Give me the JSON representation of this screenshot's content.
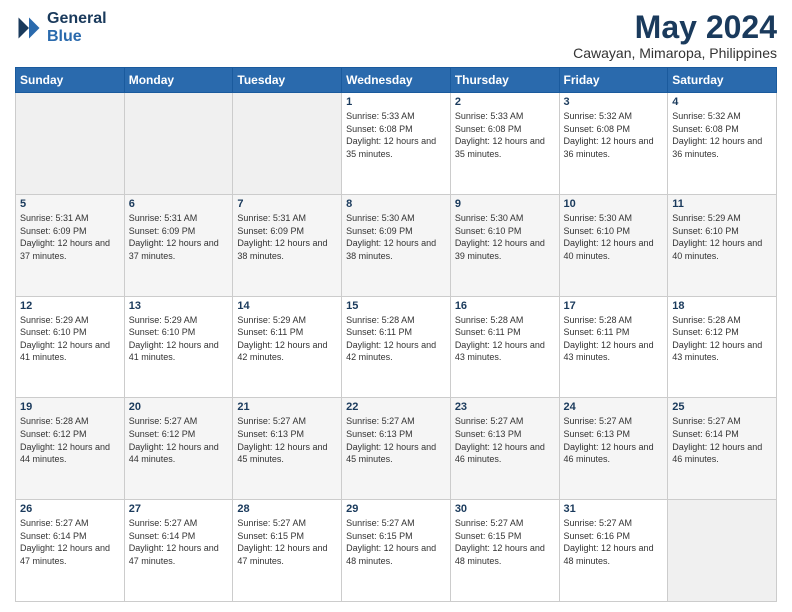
{
  "header": {
    "logo_line1": "General",
    "logo_line2": "Blue",
    "title": "May 2024",
    "subtitle": "Cawayan, Mimaropa, Philippines"
  },
  "columns": [
    "Sunday",
    "Monday",
    "Tuesday",
    "Wednesday",
    "Thursday",
    "Friday",
    "Saturday"
  ],
  "weeks": [
    [
      {
        "day": "",
        "empty": true
      },
      {
        "day": "",
        "empty": true
      },
      {
        "day": "",
        "empty": true
      },
      {
        "day": "1",
        "sunrise": "5:33 AM",
        "sunset": "6:08 PM",
        "daylight": "12 hours and 35 minutes."
      },
      {
        "day": "2",
        "sunrise": "5:33 AM",
        "sunset": "6:08 PM",
        "daylight": "12 hours and 35 minutes."
      },
      {
        "day": "3",
        "sunrise": "5:32 AM",
        "sunset": "6:08 PM",
        "daylight": "12 hours and 36 minutes."
      },
      {
        "day": "4",
        "sunrise": "5:32 AM",
        "sunset": "6:08 PM",
        "daylight": "12 hours and 36 minutes."
      }
    ],
    [
      {
        "day": "5",
        "sunrise": "5:31 AM",
        "sunset": "6:09 PM",
        "daylight": "12 hours and 37 minutes."
      },
      {
        "day": "6",
        "sunrise": "5:31 AM",
        "sunset": "6:09 PM",
        "daylight": "12 hours and 37 minutes."
      },
      {
        "day": "7",
        "sunrise": "5:31 AM",
        "sunset": "6:09 PM",
        "daylight": "12 hours and 38 minutes."
      },
      {
        "day": "8",
        "sunrise": "5:30 AM",
        "sunset": "6:09 PM",
        "daylight": "12 hours and 38 minutes."
      },
      {
        "day": "9",
        "sunrise": "5:30 AM",
        "sunset": "6:10 PM",
        "daylight": "12 hours and 39 minutes."
      },
      {
        "day": "10",
        "sunrise": "5:30 AM",
        "sunset": "6:10 PM",
        "daylight": "12 hours and 40 minutes."
      },
      {
        "day": "11",
        "sunrise": "5:29 AM",
        "sunset": "6:10 PM",
        "daylight": "12 hours and 40 minutes."
      }
    ],
    [
      {
        "day": "12",
        "sunrise": "5:29 AM",
        "sunset": "6:10 PM",
        "daylight": "12 hours and 41 minutes."
      },
      {
        "day": "13",
        "sunrise": "5:29 AM",
        "sunset": "6:10 PM",
        "daylight": "12 hours and 41 minutes."
      },
      {
        "day": "14",
        "sunrise": "5:29 AM",
        "sunset": "6:11 PM",
        "daylight": "12 hours and 42 minutes."
      },
      {
        "day": "15",
        "sunrise": "5:28 AM",
        "sunset": "6:11 PM",
        "daylight": "12 hours and 42 minutes."
      },
      {
        "day": "16",
        "sunrise": "5:28 AM",
        "sunset": "6:11 PM",
        "daylight": "12 hours and 43 minutes."
      },
      {
        "day": "17",
        "sunrise": "5:28 AM",
        "sunset": "6:11 PM",
        "daylight": "12 hours and 43 minutes."
      },
      {
        "day": "18",
        "sunrise": "5:28 AM",
        "sunset": "6:12 PM",
        "daylight": "12 hours and 43 minutes."
      }
    ],
    [
      {
        "day": "19",
        "sunrise": "5:28 AM",
        "sunset": "6:12 PM",
        "daylight": "12 hours and 44 minutes."
      },
      {
        "day": "20",
        "sunrise": "5:27 AM",
        "sunset": "6:12 PM",
        "daylight": "12 hours and 44 minutes."
      },
      {
        "day": "21",
        "sunrise": "5:27 AM",
        "sunset": "6:13 PM",
        "daylight": "12 hours and 45 minutes."
      },
      {
        "day": "22",
        "sunrise": "5:27 AM",
        "sunset": "6:13 PM",
        "daylight": "12 hours and 45 minutes."
      },
      {
        "day": "23",
        "sunrise": "5:27 AM",
        "sunset": "6:13 PM",
        "daylight": "12 hours and 46 minutes."
      },
      {
        "day": "24",
        "sunrise": "5:27 AM",
        "sunset": "6:13 PM",
        "daylight": "12 hours and 46 minutes."
      },
      {
        "day": "25",
        "sunrise": "5:27 AM",
        "sunset": "6:14 PM",
        "daylight": "12 hours and 46 minutes."
      }
    ],
    [
      {
        "day": "26",
        "sunrise": "5:27 AM",
        "sunset": "6:14 PM",
        "daylight": "12 hours and 47 minutes."
      },
      {
        "day": "27",
        "sunrise": "5:27 AM",
        "sunset": "6:14 PM",
        "daylight": "12 hours and 47 minutes."
      },
      {
        "day": "28",
        "sunrise": "5:27 AM",
        "sunset": "6:15 PM",
        "daylight": "12 hours and 47 minutes."
      },
      {
        "day": "29",
        "sunrise": "5:27 AM",
        "sunset": "6:15 PM",
        "daylight": "12 hours and 48 minutes."
      },
      {
        "day": "30",
        "sunrise": "5:27 AM",
        "sunset": "6:15 PM",
        "daylight": "12 hours and 48 minutes."
      },
      {
        "day": "31",
        "sunrise": "5:27 AM",
        "sunset": "6:16 PM",
        "daylight": "12 hours and 48 minutes."
      },
      {
        "day": "",
        "empty": true
      }
    ]
  ],
  "labels": {
    "sunrise": "Sunrise:",
    "sunset": "Sunset:",
    "daylight": "Daylight:"
  }
}
